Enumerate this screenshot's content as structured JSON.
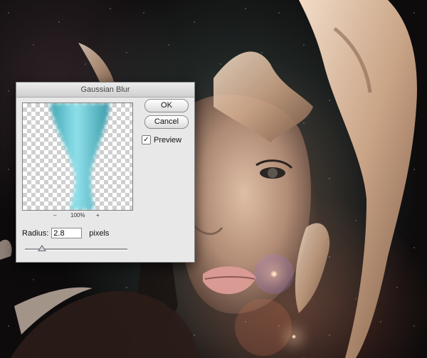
{
  "dialog": {
    "title": "Gaussian Blur",
    "ok_label": "OK",
    "cancel_label": "Cancel",
    "preview_label": "Preview",
    "preview_checked": true,
    "zoom_out_label": "–",
    "zoom_level": "100%",
    "zoom_in_label": "+",
    "radius_label": "Radius:",
    "radius_value": "2.8",
    "radius_unit": "pixels",
    "slider_fraction": 0.17
  },
  "colors": {
    "dialog_bg": "#e8e8e8",
    "preview_shape": "#5ec6d3",
    "splash": "#d8b79c"
  },
  "icons": {
    "checkbox": "checkmark-icon",
    "slider": "slider-thumb-icon"
  }
}
